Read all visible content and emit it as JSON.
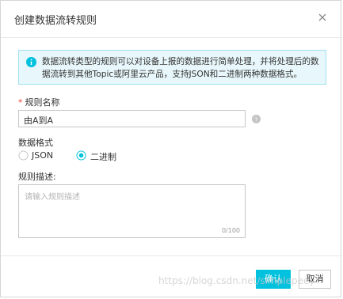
{
  "dialog": {
    "title": "创建数据流转规则",
    "close_icon": "close-icon"
  },
  "info": {
    "icon": "info-icon",
    "text": "数据流转类型的规则可以对设备上报的数据进行简单处理，并将处理后的数据流转到其他Topic或阿里云产品，支持JSON和二进制两种数据格式。",
    "color": "#00c1de"
  },
  "form": {
    "name_label": "规则名称",
    "name_value": "由A到A",
    "help_icon": "help-icon",
    "format_label": "数据格式",
    "format_options": [
      "JSON",
      "二进制"
    ],
    "format_selected": "二进制",
    "desc_label": "规则描述:",
    "desc_placeholder": "请输入规则描述",
    "desc_counter": "0/100"
  },
  "footer": {
    "confirm_label": "确认",
    "cancel_label": "取消"
  },
  "watermark": "https://blog.csdn.net/simplepeey",
  "colors": {
    "primary": "#00c1de",
    "required": "#f04134"
  }
}
